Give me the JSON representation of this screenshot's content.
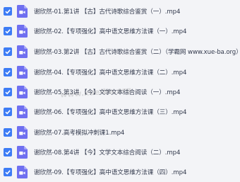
{
  "files": [
    {
      "name": "谢欣然-01.第1讲 【古】古代诗歌综合鉴赏（一）.mp4",
      "checked": true
    },
    {
      "name": "谢欣然-02.【专项强化】高中语文思维方法课（一）.mp4",
      "checked": true
    },
    {
      "name": "谢欣然-03.第2讲 【古】古代诗歌综合鉴赏（二）（学霸网 www.xue-ba.org）.mp4",
      "checked": true
    },
    {
      "name": "谢欣然-04.【专项强化】高中语文思维方法课（二）.mp4",
      "checked": true
    },
    {
      "name": "谢欣然-05.第3讲 【今】文学文本综合阅读（一）.mp4",
      "checked": true
    },
    {
      "name": "谢欣然-06.【专项强化】高中语文思维方法课（三）.mp4",
      "checked": true
    },
    {
      "name": "谢欣然-07.高考模拟冲刺课1.mp4",
      "checked": true
    },
    {
      "name": "谢欣然-08.第4讲 【今】文学文本综合阅读（二）.mp4",
      "checked": true
    },
    {
      "name": "谢欣然-09.【专项强化】高中语文思维方法课（四）.mp4",
      "checked": true
    }
  ],
  "watermark": "www.xue-ba.org",
  "colors": {
    "checkbox": "#3d7cf5",
    "file_icon": "#6f6ff0",
    "background": "#f3f4f7"
  },
  "icons": {
    "checkbox": "checkmark-icon",
    "file": "video-file-icon"
  }
}
